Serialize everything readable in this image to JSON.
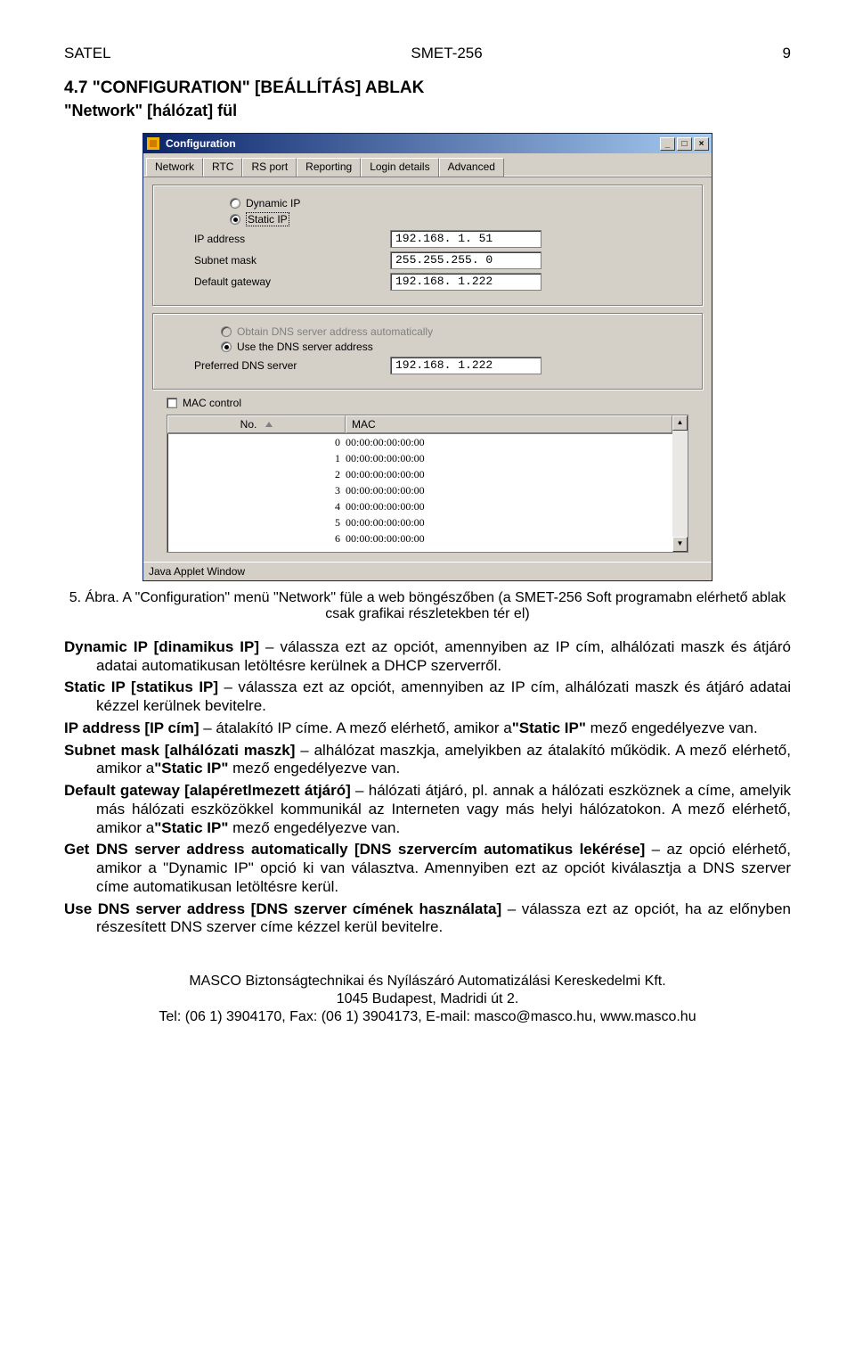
{
  "header": {
    "left": "SATEL",
    "center": "SMET-256",
    "right": "9"
  },
  "section": {
    "number": "4.7",
    "title_html": "\"CONFIGURATION\" [BEÁLLÍTÁS] ABLAK",
    "subtitle": "\"Network\" [hálózat] fül"
  },
  "window": {
    "title": "Configuration",
    "win_buttons": {
      "min": "_",
      "max": "□",
      "close": "×"
    },
    "tabs": [
      "Network",
      "RTC",
      "RS port",
      "Reporting",
      "Login details",
      "Advanced"
    ],
    "active_tab_index": 0,
    "group1": {
      "radio_dynamic": "Dynamic IP",
      "radio_static": "Static IP",
      "selected": "static",
      "fields": {
        "ip_label": "IP address",
        "ip_value": "192.168.  1. 51",
        "mask_label": "Subnet mask",
        "mask_value": "255.255.255.  0",
        "gw_label": "Default gateway",
        "gw_value": "192.168.  1.222"
      }
    },
    "group2": {
      "radio_auto": "Obtain DNS server address automatically",
      "radio_use": "Use the DNS server address",
      "selected": "use",
      "auto_disabled": true,
      "dns_label": "Preferred DNS server",
      "dns_value": "192.168.  1.222"
    },
    "mac": {
      "checkbox_label": "MAC control",
      "checked": false,
      "cols": {
        "no": "No.",
        "mac": "MAC"
      },
      "rows": [
        {
          "no": "0",
          "mac": "00:00:00:00:00:00"
        },
        {
          "no": "1",
          "mac": "00:00:00:00:00:00"
        },
        {
          "no": "2",
          "mac": "00:00:00:00:00:00"
        },
        {
          "no": "3",
          "mac": "00:00:00:00:00:00"
        },
        {
          "no": "4",
          "mac": "00:00:00:00:00:00"
        },
        {
          "no": "5",
          "mac": "00:00:00:00:00:00"
        },
        {
          "no": "6",
          "mac": "00:00:00:00:00:00"
        }
      ],
      "scroll": {
        "up": "▲",
        "down": "▼"
      }
    },
    "statusbar": "Java Applet Window"
  },
  "figure": {
    "label": "5. Ábra.",
    "text": "A \"Configuration\" menü \"Network\" füle a web böngészőben (a SMET-256 Soft programabn elérhető ablak csak grafikai részletekben tér el)"
  },
  "body": {
    "p1_lead": "Dynamic IP [dinamikus IP]",
    "p1_rest": " – válassza ezt az opciót, amennyiben az IP cím, alhálózati maszk és átjáró adatai automatikusan letöltésre kerülnek a DHCP szerverről.",
    "p2_lead": "Static IP [statikus IP]",
    "p2_rest": " – válassza ezt az opciót, amennyiben az IP cím, alhálózati maszk és átjáró adatai kézzel kerülnek bevitelre.",
    "p3_lead": "IP address [IP cím]",
    "p3_mid": " – átalakító IP címe. A mező elérhető, amikor a",
    "p3_b": "\"Static IP\"",
    "p3_end": " mező engedélyezve van.",
    "p4_lead": "Subnet mask [alhálózati maszk]",
    "p4_mid": " – alhálózat maszkja, amelyikben az átalakító működik. A mező elérhető, amikor a",
    "p4_b": "\"Static IP\"",
    "p4_end": " mező engedélyezve van.",
    "p5_lead": "Default gateway [alapéretlmezett átjáró]",
    "p5_mid": " – hálózati átjáró, pl. annak a hálózati eszköznek a címe, amelyik más hálózati eszközökkel kommunikál az Interneten vagy más helyi hálózatokon. A mező elérhető, amikor a",
    "p5_b": "\"Static IP\"",
    "p5_end": " mező engedélyezve van.",
    "p6_lead": "Get DNS server address automatically [DNS szervercím automatikus lekérése]",
    "p6_rest": " – az opció elérhető, amikor a \"Dynamic IP\" opció ki van választva. Amennyiben ezt az opciót kiválasztja a DNS szerver címe automatikusan letöltésre kerül.",
    "p7_lead": "Use DNS server address [DNS szerver címének használata]",
    "p7_rest": " – válassza ezt az opciót, ha az előnyben részesített DNS szerver címe kézzel kerül bevitelre."
  },
  "footer": {
    "l1": "MASCO Biztonságtechnikai és Nyílászáró Automatizálási Kereskedelmi Kft.",
    "l2": "1045 Budapest, Madridi út 2.",
    "l3": "Tel: (06 1) 3904170, Fax: (06 1) 3904173, E-mail: masco@masco.hu, www.masco.hu"
  }
}
